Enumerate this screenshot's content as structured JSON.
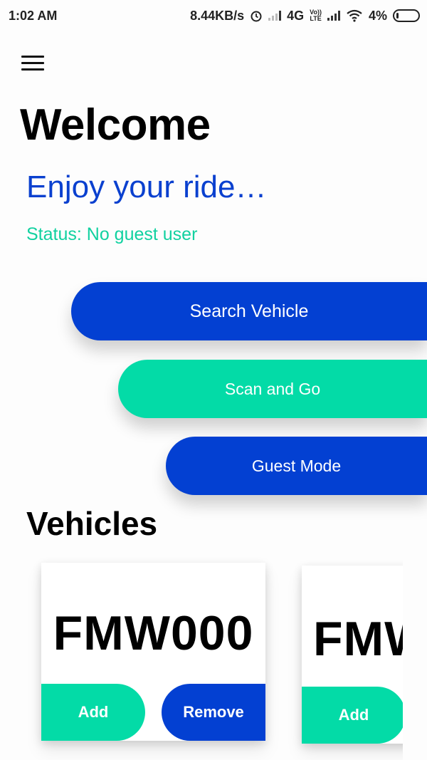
{
  "statusbar": {
    "time": "1:02 AM",
    "speed": "8.44KB/s",
    "network": "4G",
    "lte_top": "Vo))",
    "lte_bottom": "LTE",
    "battery": "4%"
  },
  "header": {
    "title": "Welcome",
    "subtitle": "Enjoy your ride…",
    "status": "Status: No guest user"
  },
  "actions": {
    "search_label": "Search Vehicle",
    "scan_label": "Scan and Go",
    "guest_label": "Guest Mode"
  },
  "vehicles": {
    "title": "Vehicles",
    "cards": [
      {
        "plate": "FMW000",
        "add_label": "Add",
        "remove_label": "Remove"
      },
      {
        "plate": "FMW",
        "add_label": "Add"
      }
    ]
  },
  "colors": {
    "primary_blue": "#0340d2",
    "accent_green": "#03dba7",
    "status_green": "#11d1a0"
  },
  "icons": [
    "menu-icon",
    "alarm-icon",
    "signal-icon",
    "wifi-icon",
    "battery-icon"
  ]
}
